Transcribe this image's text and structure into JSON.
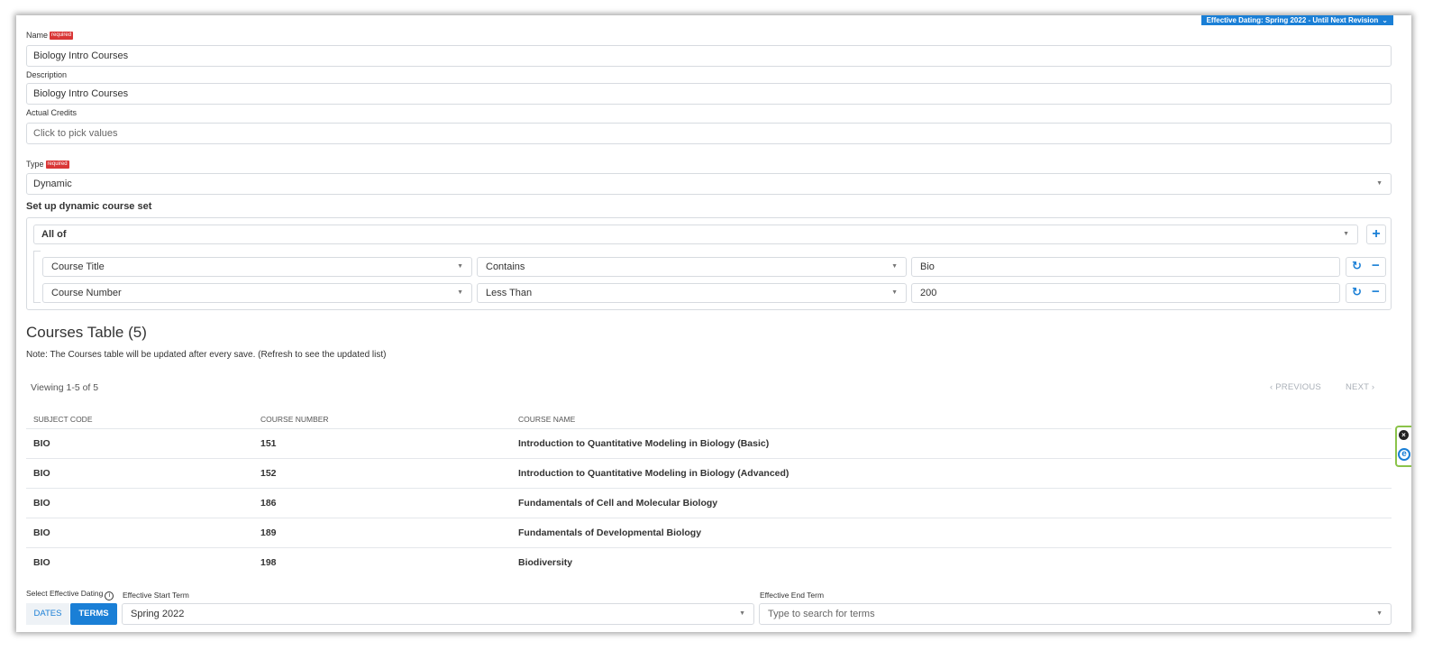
{
  "effective_badge": "Effective Dating: Spring 2022 - Until Next Revision",
  "required_label": "required",
  "name": {
    "label": "Name",
    "value": "Biology Intro Courses"
  },
  "description": {
    "label": "Description",
    "value": "Biology Intro Courses"
  },
  "actual_credits": {
    "label": "Actual Credits",
    "placeholder": "Click to pick values"
  },
  "type": {
    "label": "Type",
    "value": "Dynamic"
  },
  "dynamic_set": {
    "heading": "Set up dynamic course set",
    "group_operator": "All of",
    "conditions": [
      {
        "field": "Course Title",
        "operator": "Contains",
        "value": "Bio"
      },
      {
        "field": "Course Number",
        "operator": "Less Than",
        "value": "200"
      }
    ]
  },
  "courses_table": {
    "title": "Courses Table (5)",
    "note": "Note: The Courses table will be updated after every save. (Refresh to see the updated list)",
    "viewing": "Viewing 1-5 of 5",
    "previous": "PREVIOUS",
    "next": "NEXT",
    "columns": [
      "SUBJECT CODE",
      "COURSE NUMBER",
      "COURSE NAME"
    ],
    "rows": [
      {
        "subject": "BIO",
        "number": "151",
        "name": "Introduction to Quantitative Modeling in Biology (Basic)"
      },
      {
        "subject": "BIO",
        "number": "152",
        "name": "Introduction to Quantitative Modeling in Biology (Advanced)"
      },
      {
        "subject": "BIO",
        "number": "186",
        "name": "Fundamentals of Cell and Molecular Biology"
      },
      {
        "subject": "BIO",
        "number": "189",
        "name": "Fundamentals of Developmental Biology"
      },
      {
        "subject": "BIO",
        "number": "198",
        "name": "Biodiversity"
      }
    ]
  },
  "effective_dating": {
    "label": "Select Effective Dating",
    "dates_label": "DATES",
    "terms_label": "TERMS",
    "start_label": "Effective Start Term",
    "start_value": "Spring 2022",
    "end_label": "Effective End Term",
    "end_placeholder": "Type to search for terms"
  },
  "colors": {
    "accent": "#1a7fd6",
    "required": "#d93636",
    "side_tab_border": "#8bc34a"
  },
  "icons": [
    "chevron-down-icon",
    "plus-icon",
    "refresh-icon",
    "minus-icon",
    "chevron-left-icon",
    "chevron-right-icon",
    "info-icon",
    "close-icon",
    "extension-e-icon"
  ]
}
